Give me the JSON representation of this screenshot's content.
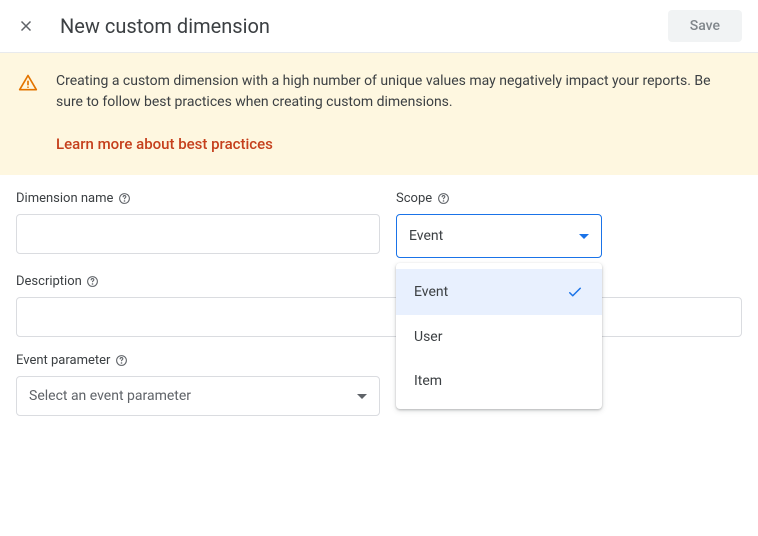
{
  "header": {
    "title": "New custom dimension",
    "save_label": "Save"
  },
  "warning": {
    "text": "Creating a custom dimension with a high number of unique values may negatively impact your reports. Be sure to follow best practices when creating custom dimensions.",
    "link_label": "Learn more about best practices"
  },
  "form": {
    "dimension_name": {
      "label": "Dimension name",
      "value": ""
    },
    "scope": {
      "label": "Scope",
      "selected": "Event",
      "options": [
        "Event",
        "User",
        "Item"
      ]
    },
    "description": {
      "label": "Description",
      "value": ""
    },
    "event_parameter": {
      "label": "Event parameter",
      "placeholder": "Select an event parameter"
    }
  }
}
